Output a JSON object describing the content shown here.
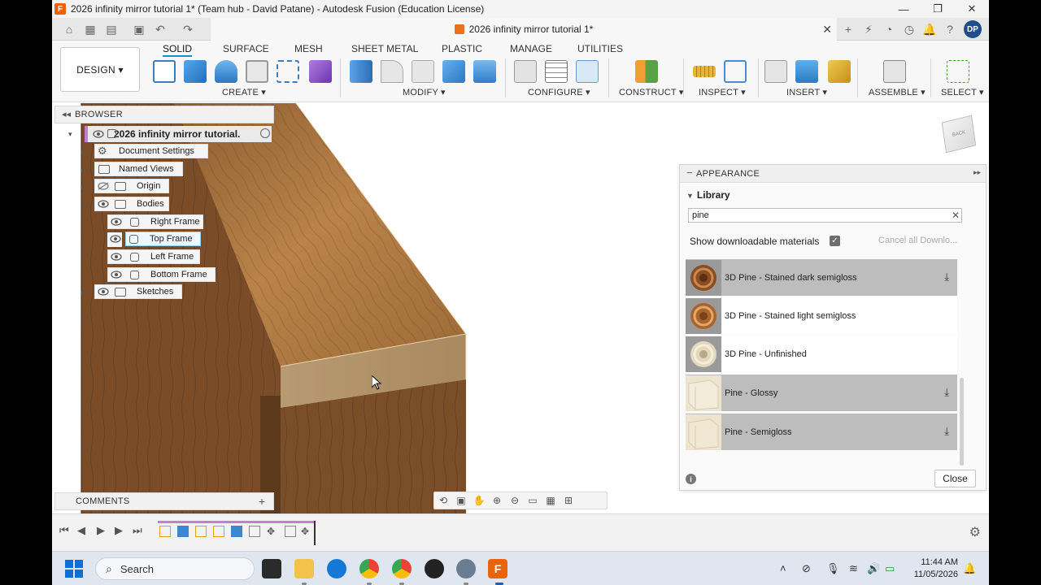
{
  "window": {
    "title": "2026 infinity mirror tutorial 1* (Team hub - David Patane) - Autodesk Fusion (Education License)",
    "app_logo": "F",
    "controls": [
      "minimize-icon",
      "restore-icon",
      "close-icon"
    ]
  },
  "doc_tab": {
    "title": "2026 infinity mirror tutorial 1*",
    "user_initials": "DP"
  },
  "ribbon": {
    "workspace": "DESIGN ▾",
    "tabs": [
      "SOLID",
      "SURFACE",
      "MESH",
      "SHEET METAL",
      "PLASTIC",
      "MANAGE",
      "UTILITIES"
    ],
    "active_tab": "SOLID",
    "groups": [
      "CREATE ▾",
      "MODIFY ▾",
      "CONFIGURE ▾",
      "CONSTRUCT ▾",
      "INSPECT ▾",
      "INSERT ▾",
      "ASSEMBLE ▾",
      "SELECT ▾"
    ],
    "accent": "#0696d7"
  },
  "browser": {
    "header": "BROWSER",
    "root": "2026 infinity mirror tutorial...",
    "nodes": [
      "Document Settings",
      "Named Views",
      "Origin",
      "Bodies",
      "Sketches"
    ],
    "bodies": [
      "Right Frame",
      "Top Frame",
      "Left Frame",
      "Bottom Frame"
    ],
    "selected_body": "Top Frame"
  },
  "comments": {
    "header": "COMMENTS",
    "add": "+"
  },
  "viewcube": {
    "face": "BACK"
  },
  "appearance": {
    "header": "APPEARANCE",
    "library_label": "Library",
    "search_value": "pine",
    "downloadable_label": "Show downloadable materials",
    "downloadable_checked": true,
    "cancel_downloads": "Cancel all Downlo...",
    "materials": [
      {
        "name": "3D Pine - Stained dark semigloss",
        "downloadable": true
      },
      {
        "name": "3D Pine - Stained light semigloss",
        "downloadable": false
      },
      {
        "name": "3D Pine - Unfinished",
        "downloadable": false
      },
      {
        "name": "Pine - Glossy",
        "downloadable": true
      },
      {
        "name": "Pine - Semigloss",
        "downloadable": true
      }
    ],
    "close_label": "Close"
  },
  "taskbar": {
    "search_placeholder": "Search",
    "time": "11:44 AM",
    "date": "11/05/2026"
  }
}
